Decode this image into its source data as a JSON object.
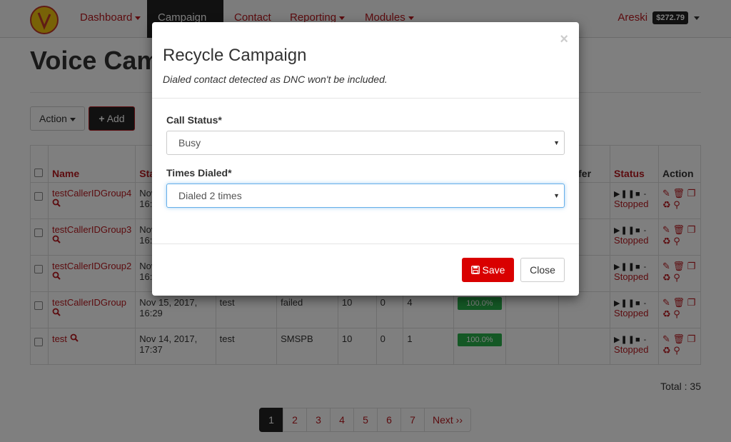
{
  "nav": {
    "items": [
      {
        "label": "Dashboard",
        "dropdown": true
      },
      {
        "label": "Campaign",
        "dropdown": false,
        "active": true
      },
      {
        "label": "Contact",
        "dropdown": false
      },
      {
        "label": "Reporting",
        "dropdown": true
      },
      {
        "label": "Modules",
        "dropdown": true
      }
    ],
    "user_name": "Areski",
    "balance": "$272.79"
  },
  "page": {
    "title": "Voice Campaign",
    "action_label": "Action",
    "add_label": "Add",
    "total": "Total : 35"
  },
  "table": {
    "headers": {
      "name": "Name",
      "start": "Start",
      "xfer": "e-Xfer",
      "status": "Status",
      "action": "Action"
    },
    "rows": [
      {
        "name": "testCallerIDGroup4",
        "date": "Nov 15, 2017,",
        "time": "16:30",
        "phonebook": "",
        "gateway": "",
        "a": "",
        "b": "",
        "c": "",
        "progress": "",
        "status": "Stopped"
      },
      {
        "name": "testCallerIDGroup3",
        "date": "Nov 15, 2017,",
        "time": "16:30",
        "phonebook": "",
        "gateway": "",
        "a": "",
        "b": "",
        "c": "",
        "progress": "",
        "status": "Stopped"
      },
      {
        "name": "testCallerIDGroup2",
        "date": "Nov 15, 2017,",
        "time": "16:30",
        "phonebook": "",
        "gateway": "",
        "a": "",
        "b": "",
        "c": "",
        "progress": "",
        "status": "Stopped"
      },
      {
        "name": "testCallerIDGroup",
        "date": "Nov 15, 2017,",
        "time": "16:29",
        "phonebook": "test",
        "gateway": "failed",
        "a": "10",
        "b": "0",
        "c": "4",
        "progress": "100.0%",
        "status": "Stopped"
      },
      {
        "name": "test",
        "date": "Nov 14, 2017,",
        "time": "17:37",
        "phonebook": "test",
        "gateway": "SMSPB",
        "a": "10",
        "b": "0",
        "c": "1",
        "progress": "100.0%",
        "status": "Stopped"
      }
    ]
  },
  "pagination": {
    "pages": [
      "1",
      "2",
      "3",
      "4",
      "5",
      "6",
      "7"
    ],
    "active": "1",
    "next_label": "Next ››"
  },
  "modal": {
    "title": "Recycle Campaign",
    "subtitle": "Dialed contact detected as DNC won't be included.",
    "close_symbol": "×",
    "call_status_label": "Call Status*",
    "call_status_value": "Busy",
    "times_dialed_label": "Times Dialed*",
    "times_dialed_value": "Dialed 2 times",
    "save_label": "Save",
    "close_label": "Close"
  },
  "colors": {
    "accent": "#b8181e",
    "save": "#d90000",
    "progress": "#28b04b",
    "dark": "#222222"
  }
}
